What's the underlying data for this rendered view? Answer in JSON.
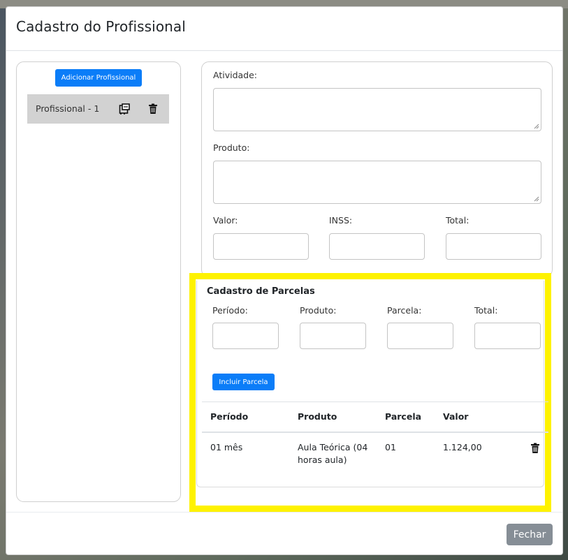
{
  "modal": {
    "title": "Cadastro do Profissional",
    "close_label": "Fechar"
  },
  "left": {
    "add_button_label": "Adicionar Profissional",
    "items": [
      {
        "label": "Profissional - 1",
        "icons": [
          "edit-icon",
          "trash-icon"
        ]
      }
    ]
  },
  "form": {
    "atividade_label": "Atividade:",
    "atividade_value": "",
    "produto_label": "Produto:",
    "produto_value": "",
    "valor_label": "Valor:",
    "valor_value": "",
    "inss_label": "INSS:",
    "inss_value": "",
    "total_label": "Total:",
    "total_value": ""
  },
  "parcelas": {
    "title": "Cadastro de Parcelas",
    "periodo_label": "Período:",
    "produto_label": "Produto:",
    "parcela_label": "Parcela:",
    "total_label": "Total:",
    "include_label": "Incluir Parcela",
    "table": {
      "headers": [
        "Período",
        "Produto",
        "Parcela",
        "Valor"
      ],
      "rows": [
        {
          "periodo": "01 mês",
          "produto": "Aula Teórica (04 horas aula)",
          "parcela": "01",
          "valor": "1.124,00"
        }
      ]
    }
  },
  "colors": {
    "primary": "#0b7df8",
    "secondary": "#868e96",
    "highlight": "#fef200",
    "selected_item": "#d2d2d2"
  }
}
